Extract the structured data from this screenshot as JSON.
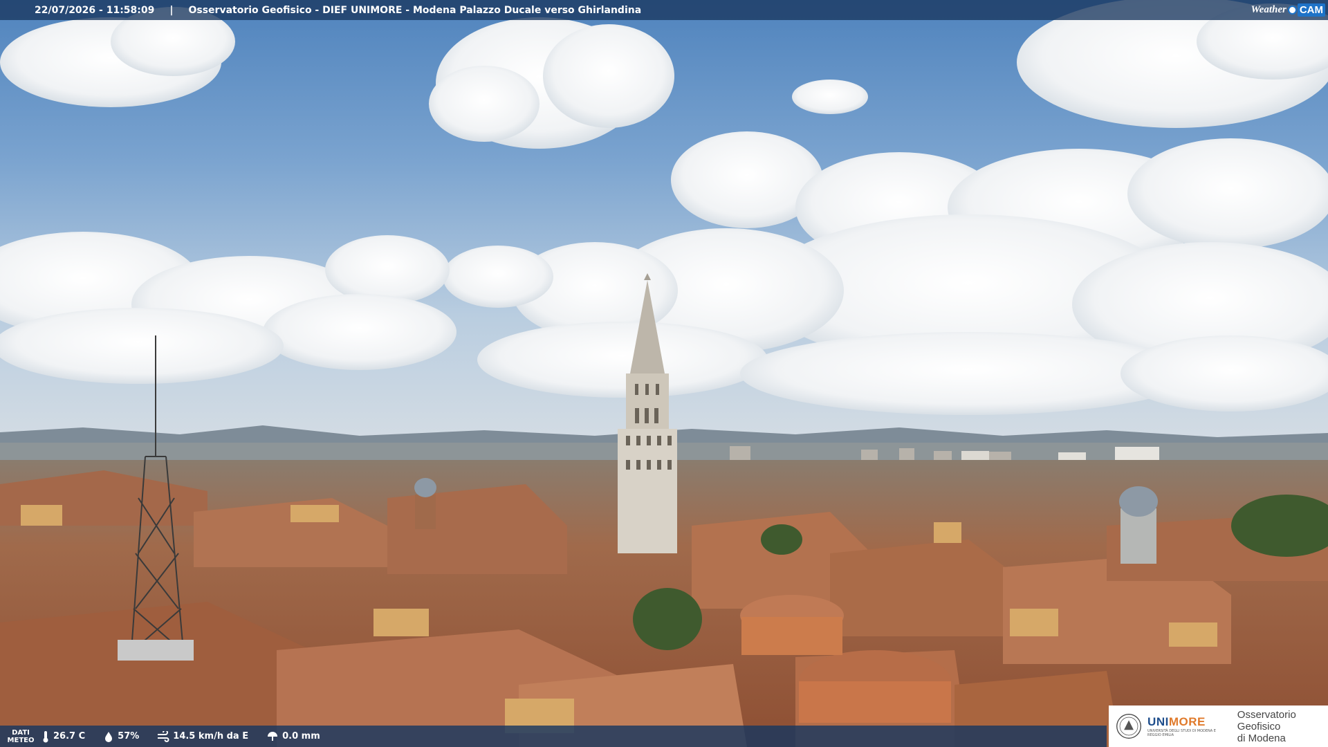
{
  "header": {
    "datetime": "22/07/2026 - 11:58:09",
    "separator": "|",
    "caption": "Osservatorio Geofisico - DIEF UNIMORE - Modena Palazzo Ducale verso Ghirlandina"
  },
  "logo": {
    "weather": "Weather",
    "cam": "CAM"
  },
  "meteo": {
    "label_line1": "DATI",
    "label_line2": "METEO",
    "temperature": "26.7 C",
    "humidity": "57%",
    "wind": "14.5 km/h da E",
    "rain": "0.0 mm"
  },
  "institution": {
    "name_a": "UNI",
    "name_b": "MORE",
    "subtitle": "UNIVERSITÀ DEGLI STUDI DI MODENA E REGGIO EMILIA",
    "line1": "Osservatorio Geofisico",
    "line2": "di Modena"
  },
  "colors": {
    "sky_top": "#5e8fc4",
    "sky_bottom": "#c9d8e3",
    "roof": "#b06a45",
    "bar": "#19375f",
    "accent": "#1e73c8"
  },
  "icons": [
    "thermometer-icon",
    "humidity-icon",
    "wind-icon",
    "rain-icon",
    "weathercam-logo-icon",
    "unimore-seal-icon"
  ]
}
